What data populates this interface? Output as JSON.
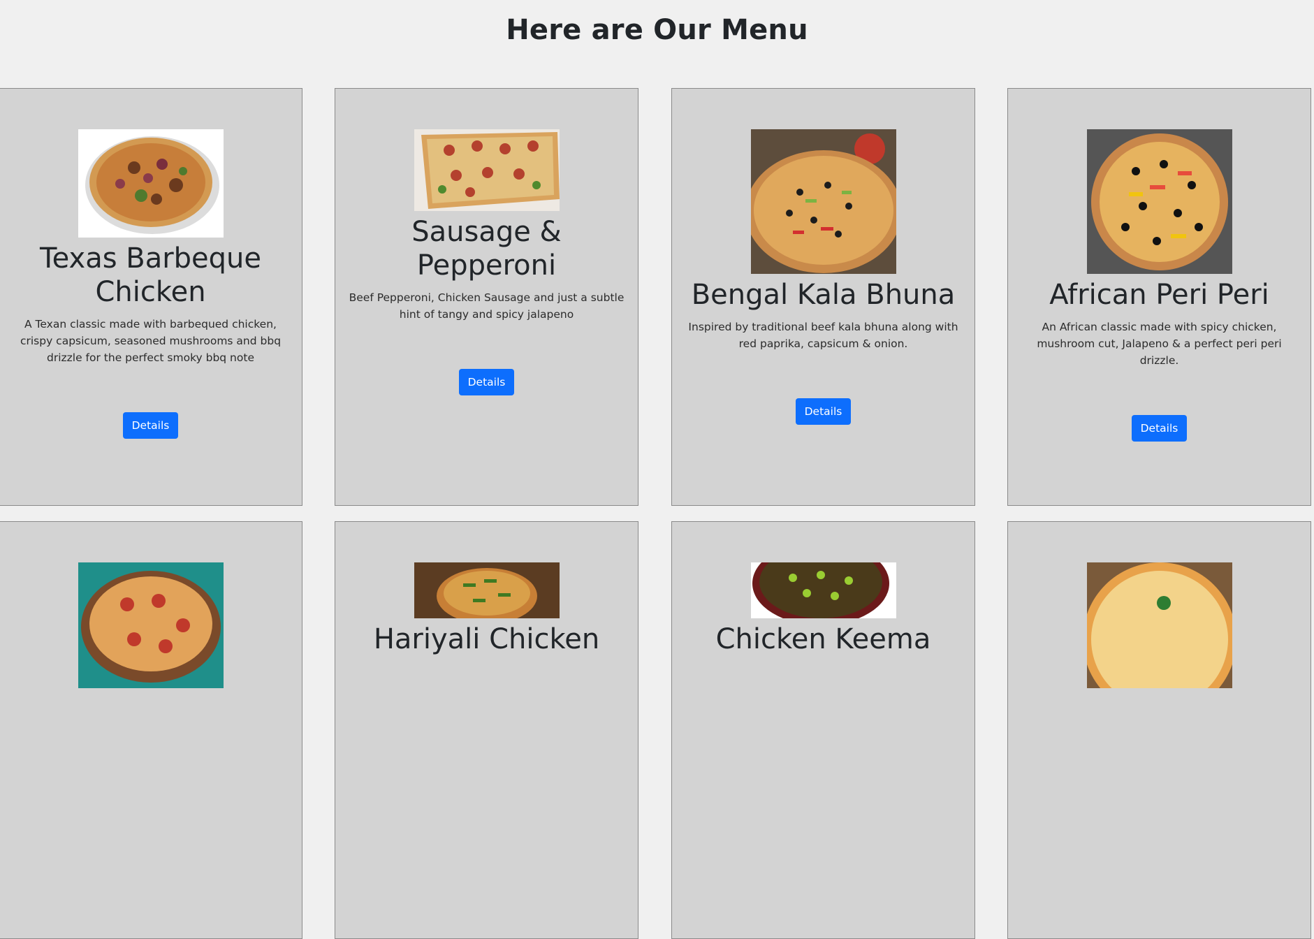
{
  "page": {
    "title": "Here are Our Menu"
  },
  "cards": [
    {
      "name": "Texas Barbeque Chicken",
      "description": "A Texan classic made with barbequed chicken, crispy capsicum, seasoned mushrooms and bbq drizzle for the perfect smoky bbq note",
      "button": "Details"
    },
    {
      "name": "Sausage & Pepperoni",
      "description": "Beef Pepperoni, Chicken Sausage and just a subtle hint of tangy and spicy jalapeno",
      "button": "Details"
    },
    {
      "name": "Bengal Kala Bhuna",
      "description": "Inspired by traditional beef kala bhuna along with red paprika, capsicum & onion.",
      "button": "Details"
    },
    {
      "name": "African Peri Peri",
      "description": "An African classic made with spicy chicken, mushroom cut, Jalapeno & a perfect peri peri drizzle.",
      "button": "Details"
    },
    {
      "name": "",
      "description": "",
      "button": ""
    },
    {
      "name": "Hariyali Chicken",
      "description": "",
      "button": ""
    },
    {
      "name": "Chicken Keema",
      "description": "",
      "button": ""
    },
    {
      "name": "",
      "description": "",
      "button": ""
    }
  ],
  "colors": {
    "page_bg": "#f0f0f0",
    "card_bg": "#d3d3d3",
    "button_bg": "#0d6efd",
    "button_text": "#ffffff"
  },
  "icons": {
    "pizza": "pizza-image"
  }
}
